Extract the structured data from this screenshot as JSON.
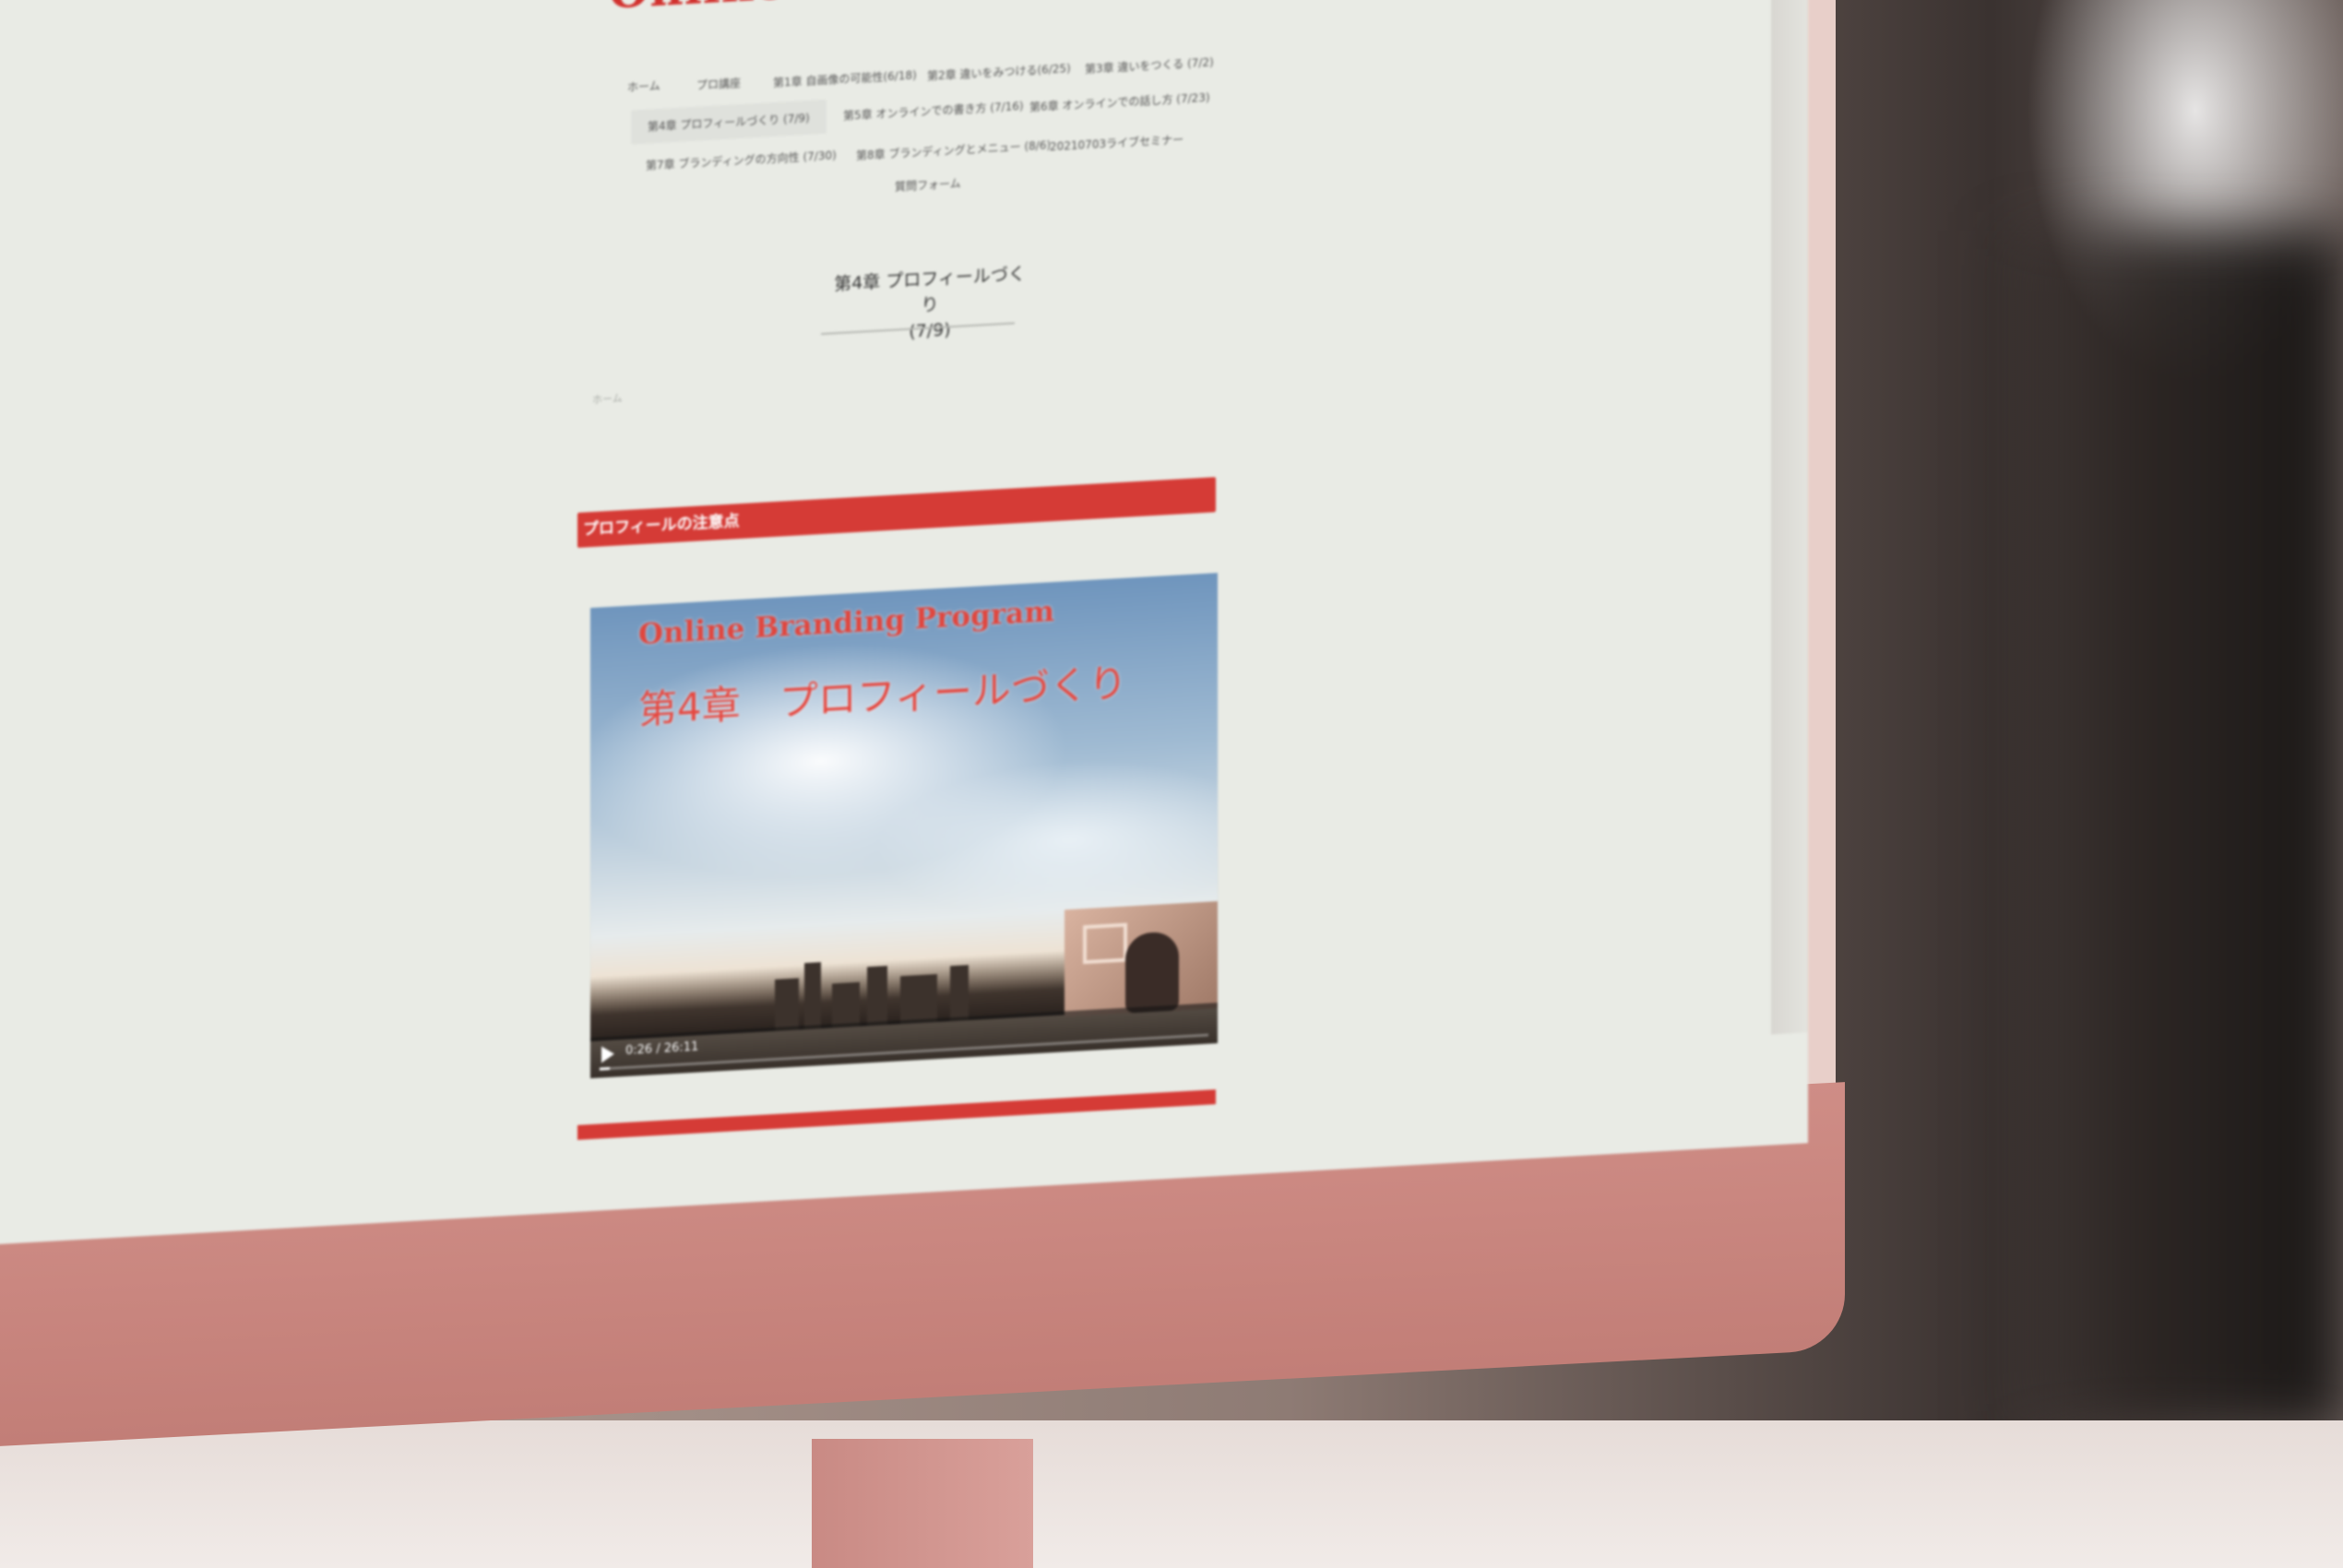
{
  "site": {
    "title": "Online Branding Program"
  },
  "nav": {
    "items": [
      {
        "label": "ホーム"
      },
      {
        "label": "プロ講座"
      },
      {
        "label": "第1章 自画像の可能性(6/18)"
      },
      {
        "label": "第2章 違いをみつける(6/25)"
      },
      {
        "label": "第3章 違いをつくる (7/2)"
      },
      {
        "label": "第4章 プロフィールづくり (7/9)"
      },
      {
        "label": "第5章 オンラインでの書き方 (7/16)"
      },
      {
        "label": "第6章 オンラインでの話し方 (7/23)"
      },
      {
        "label": "第7章 ブランディングの方向性 (7/30)"
      },
      {
        "label": "第8章 ブランディングとメニュー (8/6)"
      },
      {
        "label": "20210703ライブセミナー"
      },
      {
        "label": "質問フォーム"
      }
    ],
    "active_index": 5
  },
  "main": {
    "chapter_title_line1": "第4章 プロフィールづくり",
    "chapter_title_line2": "(7/9)",
    "breadcrumb": "ホーム",
    "section_heading": "プロフィールの注意点"
  },
  "video": {
    "title": "Online Branding Program",
    "subtitle": "第4章　プロフィールづくり",
    "time": "0:26 / 26:11",
    "progress": 0.017
  },
  "colors": {
    "brand_red": "#d2322f",
    "screen_bg": "#e9ebe5",
    "monitor_pink": "#cf8d86"
  }
}
